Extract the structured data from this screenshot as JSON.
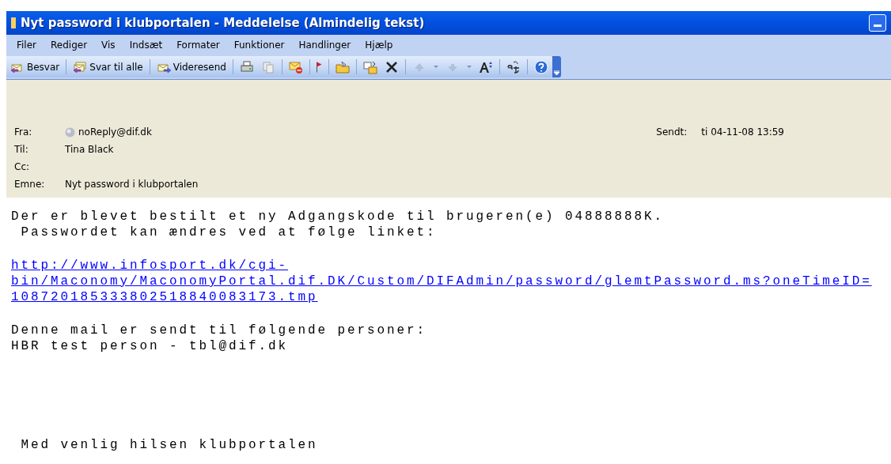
{
  "window": {
    "title": "Nyt password i klubportalen - Meddelelse (Almindelig tekst)"
  },
  "menu": [
    "Filer",
    "Rediger",
    "Vis",
    "Indsæt",
    "Formater",
    "Funktioner",
    "Handlinger",
    "Hjælp"
  ],
  "toolbar": [
    {
      "label": "Besvar"
    },
    {
      "label": "Svar til alle"
    },
    {
      "label": "Videresend"
    }
  ],
  "header": {
    "fields": [
      {
        "label": "Fra:",
        "value": "noReply@dif.dk",
        "kind": "sender"
      },
      {
        "label": "Til:",
        "value": "Tina Black",
        "kind": "plain"
      },
      {
        "label": "Cc:",
        "kind": "plain"
      },
      {
        "label": "Emne:",
        "value": "Nyt password i klubportalen",
        "kind": "plain"
      }
    ],
    "sent": {
      "label": "Sendt:",
      "value": "ti 04-11-08 13:59"
    }
  },
  "body": [
    {
      "kind": "text",
      "lines": [
        "Der er blevet bestilt et ny Adgangskode til brugeren(e) 04888888K.",
        " Passwordet kan ændres ved at følge linket:"
      ]
    },
    {
      "kind": "link",
      "lines": [
        "http://www.infosport.dk/cgi-",
        "bin/Maconomy/MaconomyPortal.dif.DK/Custom/DIFAdmin/password/glemtPassword.ms?oneTimeID=",
        "108720185333802518840083173.tmp"
      ]
    },
    {
      "kind": "text",
      "lines": [
        "Denne mail er sendt til følgende personer:",
        "HBR test person - tbl@dif.dk"
      ]
    },
    {
      "kind": "gap"
    },
    {
      "kind": "text",
      "lines": [
        " Med venlig hilsen klubportalen"
      ]
    }
  ]
}
